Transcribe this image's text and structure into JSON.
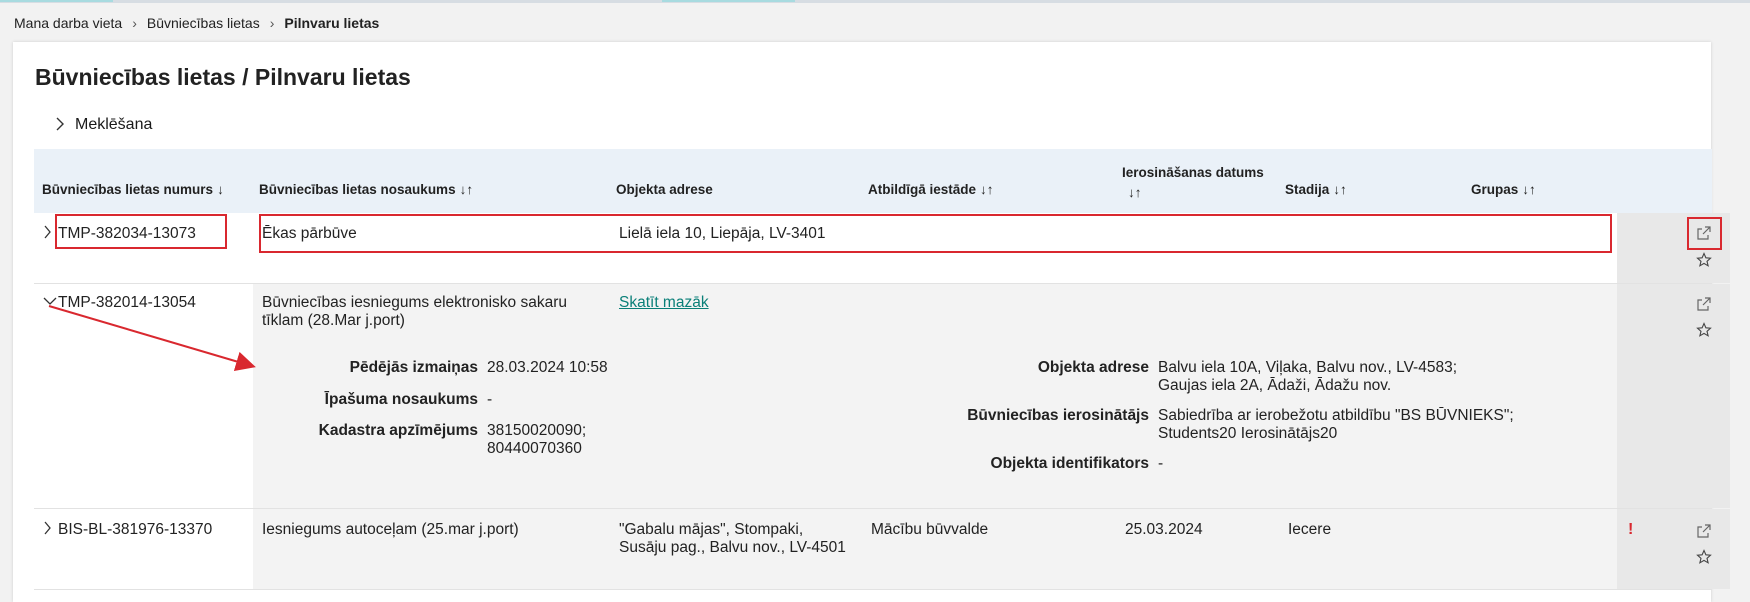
{
  "breadcrumb": {
    "items": [
      "Mana darba vieta",
      "Būvniecības lietas",
      "Pilnvaru lietas"
    ]
  },
  "page_title": "Būvniecības lietas / Pilnvaru lietas",
  "search": {
    "label": "Meklēšana"
  },
  "table": {
    "headers": {
      "number": "Būvniecības lietas numurs",
      "name": "Būvniecības lietas nosaukums",
      "address": "Objekta adrese",
      "authority": "Atbildīgā iestāde",
      "date": "Ierosināšanas datums",
      "stage": "Stadija",
      "groups": "Grupas",
      "sort_desc": "↓",
      "sort_both": "↓↑"
    },
    "rows": [
      {
        "number": "TMP-382034-13073",
        "name": "Ēkas pārbūve",
        "address": "Lielā iela 10, Liepāja, LV-3401",
        "expand_icon": "chevron-right-icon"
      },
      {
        "number": "TMP-382014-13054",
        "name_line1": "Būvniecības iesniegums elektronisko sakaru",
        "name_line2": "tīklam (28.Mar j.port)",
        "show_less": "Skatīt mazāk",
        "expand_icon": "chevron-down-icon",
        "details": {
          "last_change_label": "Pēdējās izmaiņas",
          "last_change_value": "28.03.2024 10:58",
          "property_label": "Īpašuma nosaukums",
          "property_value": "-",
          "cadastre_label": "Kadastra apzīmējums",
          "cadastre_line1": "38150020090;",
          "cadastre_line2": "80440070360",
          "address_label": "Objekta adrese",
          "address_line1": "Balvu iela 10A, Viļaka, Balvu nov., LV-4583;",
          "address_line2": "Gaujas iela 2A, Ādaži, Ādažu nov.",
          "initiator_label": "Būvniecības ierosinātājs",
          "initiator_line1": "Sabiedrība ar ierobežotu atbildību \"BS BŪVNIEKS\";",
          "initiator_line2": "Students20 Ierosinātājs20",
          "object_id_label": "Objekta identifikators",
          "object_id_value": "-"
        }
      },
      {
        "number": "BIS-BL-381976-13370",
        "name": "Iesniegums autoceļam (25.mar j.port)",
        "address_line1": "\"Gabalu mājas\", Stompaki,",
        "address_line2": "Susāju pag., Balvu nov., LV-4501",
        "authority": "Mācību būvvalde",
        "date": "25.03.2024",
        "stage": "Iecere",
        "alert": "!",
        "expand_icon": "chevron-right-icon"
      }
    ]
  },
  "colors": {
    "accent_link": "#0a7f78",
    "annotation_red": "#d9282f",
    "header_bg": "#eaf1f8"
  }
}
